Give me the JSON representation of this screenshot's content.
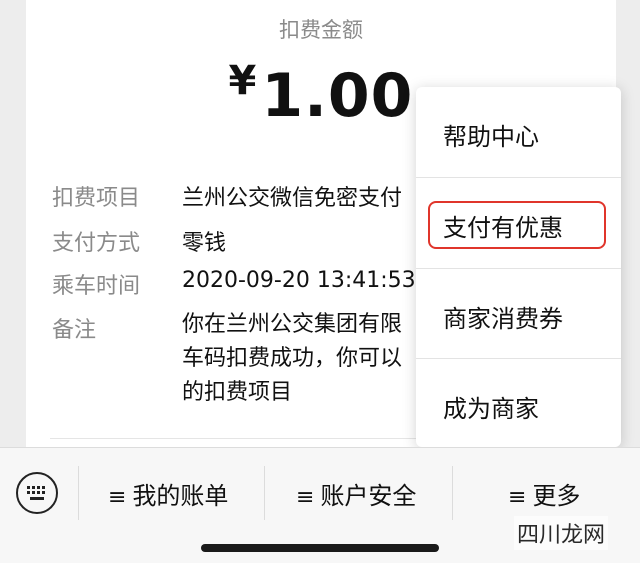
{
  "receipt": {
    "amount_label": "扣费金额",
    "currency_symbol": "¥",
    "amount": "1.00",
    "details": [
      {
        "key": "扣费项目",
        "value": "兰州公交微信免密支付"
      },
      {
        "key": "支付方式",
        "value": "零钱"
      },
      {
        "key": "乘车时间",
        "value": "2020-09-20 13:41:53"
      },
      {
        "key": "备注",
        "value_lines": [
          "你在兰州公交集团有限",
          "车码扣费成功，你可以",
          "的扣费项目"
        ]
      }
    ]
  },
  "menu": {
    "items": [
      "帮助中心",
      "支付有优惠",
      "商家消费券",
      "成为商家"
    ],
    "highlighted_item": "支付有优惠",
    "highlight_color": "#e0352b"
  },
  "bottom_bar": {
    "keyboard_icon": "keyboard-icon",
    "tabs": [
      "我的账单",
      "账户安全",
      "更多"
    ],
    "tab_icon": "≡"
  },
  "watermark": "四川龙网"
}
